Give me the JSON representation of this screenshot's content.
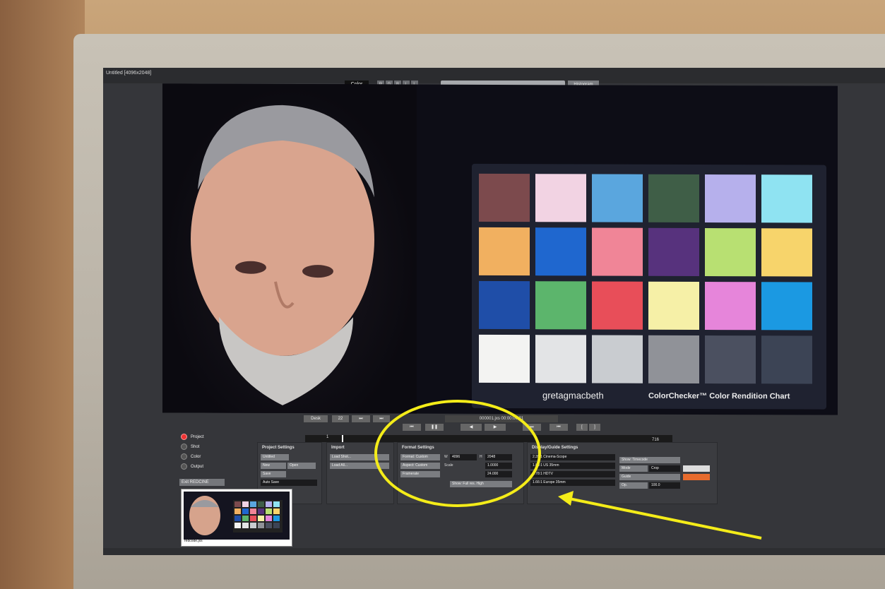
{
  "window": {
    "title": "Untitled [4096x2048]"
  },
  "toolbar": {
    "color_tab": "Color",
    "channels": [
      "R",
      "G",
      "B",
      "L",
      "L"
    ],
    "histogram_label": "Histogram",
    "zoom_buttons": [
      "−",
      "+",
      "-|-",
      "-|-"
    ]
  },
  "viewer": {
    "chart_brand": "gretagmacbeth",
    "chart_name": "ColorChecker™ Color Rendition Chart",
    "swatches": [
      "#7c4a4d",
      "#f2d3e3",
      "#5aa6de",
      "#3f5e47",
      "#b6b0ec",
      "#8fe3f2",
      "#f1b060",
      "#1f67cf",
      "#f08597",
      "#57327d",
      "#b8e072",
      "#f7d46b",
      "#1f4ea8",
      "#5cb56c",
      "#e84e59",
      "#f6f0a7",
      "#e685da",
      "#1b99e2",
      "#f3f3f2",
      "#e3e4e6",
      "#c9ccd0",
      "#909298",
      "#4b5060",
      "#3c4455"
    ]
  },
  "transport": {
    "desk_label": "Desk",
    "speed": "22",
    "timecode": "000001.jxs 00:00:00:21",
    "frame_start": "1",
    "frame_end": "716"
  },
  "modes": {
    "items": [
      "Project",
      "Shot",
      "Color",
      "Output"
    ],
    "exit_label": "Exit REDCINE"
  },
  "project_settings": {
    "title": "Project Settings",
    "buttons": [
      "Untitled",
      "New",
      "Open",
      "Save",
      "Auto Save"
    ]
  },
  "import": {
    "title": "Import",
    "buttons": [
      "Load Shot...",
      "Load All..."
    ]
  },
  "format_settings": {
    "title": "Format Settings",
    "format": "Format: Custom",
    "aspect": "Aspect: Custom",
    "framerate": "Framerate",
    "w_label": "W",
    "w_value": "4096",
    "h_label": "H",
    "h_value": "2048",
    "scale_label": "Scale",
    "scale_value": "1.0000",
    "fps_value": "24.000",
    "quality": "Show: Full res. High"
  },
  "display_guides": {
    "title": "Display/Guide Settings",
    "rows": [
      "2.35:1 Cinema-Scope",
      "1.85:1 US 35mm",
      "1.78:1 HDTV",
      "1.66:1 Europe 35mm"
    ],
    "show_timecode": "Show: Timecode",
    "mode_label": "Mode",
    "mode_value": "Crop",
    "guide_label": "Guide",
    "op_label": "Op.",
    "op_value": "100.0"
  },
  "thumbnail": {
    "label": "redcode.jxs"
  }
}
